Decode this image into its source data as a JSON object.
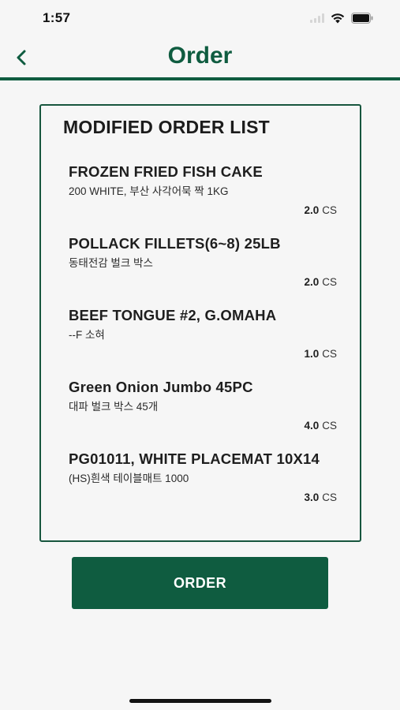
{
  "status_bar": {
    "time": "1:57"
  },
  "header": {
    "title": "Order"
  },
  "card": {
    "title": "MODIFIED ORDER LIST",
    "items": [
      {
        "name": "FROZEN FRIED FISH CAKE",
        "description": "200 WHITE, 부산 사각어묵 짝 1KG",
        "quantity": "2.0",
        "unit": "CS"
      },
      {
        "name": "POLLACK FILLETS(6~8) 25LB",
        "description": "동태전감 벌크 박스",
        "quantity": "2.0",
        "unit": "CS"
      },
      {
        "name": "BEEF TONGUE #2, G.OMAHA",
        "description": "--F 소혀",
        "quantity": "1.0",
        "unit": "CS"
      },
      {
        "name": "Green Onion Jumbo 45PC",
        "description": "대파 벌크 박스  45개",
        "quantity": "4.0",
        "unit": "CS"
      },
      {
        "name": "PG01011,  WHITE PLACEMAT 10X14",
        "description": "(HS)흰색 테이블매트 1000",
        "quantity": "3.0",
        "unit": "CS"
      }
    ]
  },
  "actions": {
    "order_label": "ORDER"
  },
  "colors": {
    "brand": "#0f5c40",
    "background": "#f6f6f6"
  }
}
